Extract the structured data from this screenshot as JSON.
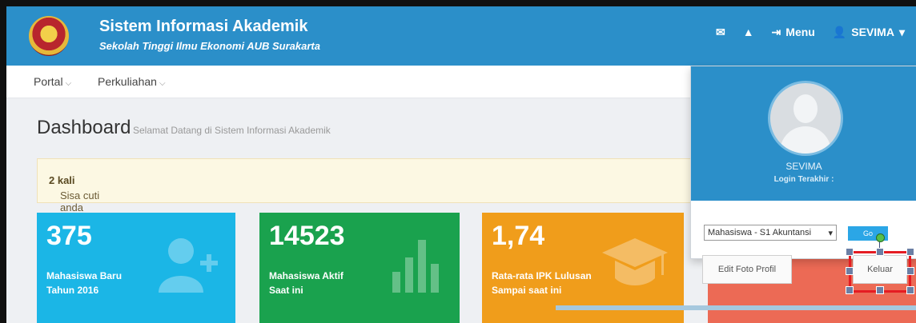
{
  "header": {
    "title": "Sistem Informasi Akademik",
    "subtitle": "Sekolah Tinggi Ilmu Ekonomi AUB Surakarta",
    "nav": {
      "mail_icon": "envelope-icon",
      "alert_icon": "warning-icon",
      "menu_label": "Menu",
      "user_label": "SEVIMA"
    }
  },
  "menubar": {
    "items": [
      {
        "label": "Portal"
      },
      {
        "label": "Perkuliahan"
      }
    ]
  },
  "dashboard": {
    "title": "Dashboard",
    "subtitle": "Selamat Datang di Sistem Informasi Akademik",
    "alert_prefix": "Sisa cuti anda sebanyak",
    "alert_value": "2 kali",
    "stats": [
      {
        "value": "375",
        "label_line1": "Mahasiswa Baru",
        "label_line2": "Tahun 2016",
        "color": "#1bb6e6",
        "icon": "add-user-icon"
      },
      {
        "value": "14523",
        "label_line1": "Mahasiswa Aktif",
        "label_line2": "Saat ini",
        "color": "#1aa24e",
        "icon": "bar-chart-icon"
      },
      {
        "value": "1,74",
        "label_line1": "Rata-rata IPK Lulusan",
        "label_line2": "Sampai saat ini",
        "color": "#f09d1b",
        "icon": "graduation-cap-icon"
      }
    ]
  },
  "user_dropdown": {
    "name": "SEVIMA",
    "login_label": "Login Terakhir :",
    "role_select": "Mahasiswa - S1 Akuntansi",
    "go_button": "Go",
    "edit_button": "Edit Foto Profil",
    "logout_button": "Keluar"
  },
  "colors": {
    "topbar": "#2b8fc9",
    "highlight": "#e51c23"
  }
}
